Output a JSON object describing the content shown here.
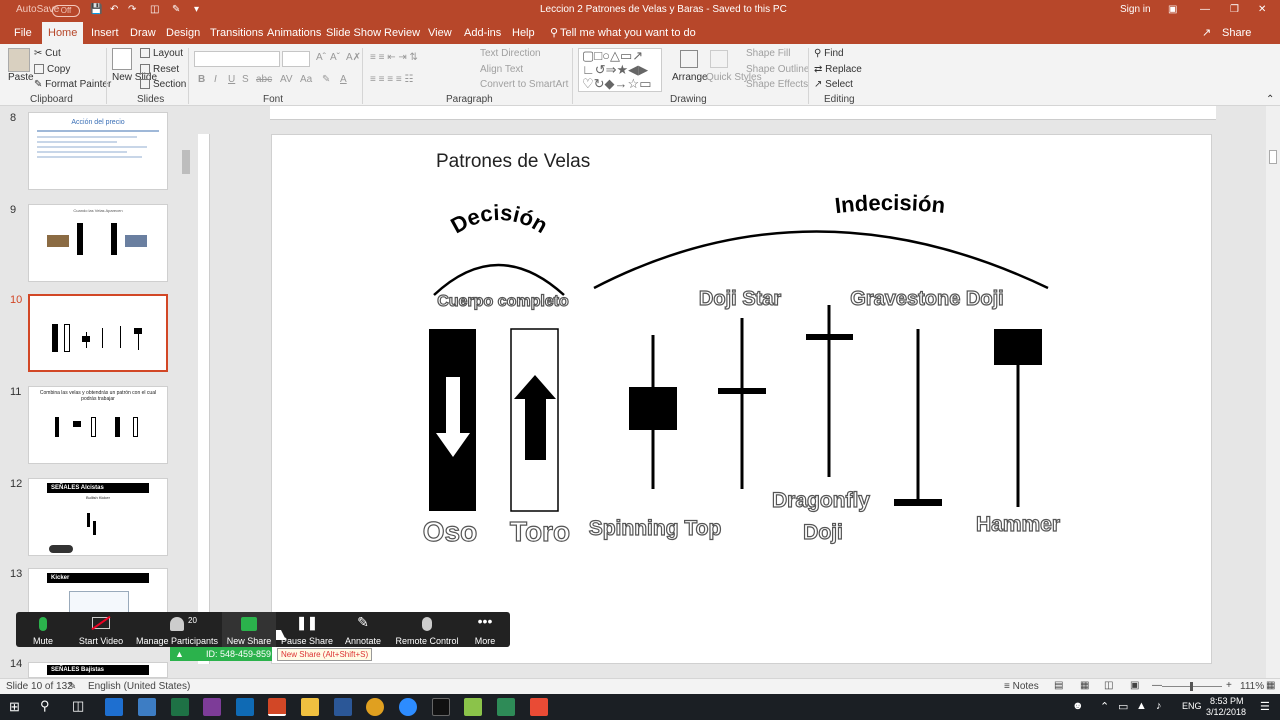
{
  "window": {
    "autosave_label": "AutoSave",
    "autosave_state": "Off",
    "document_title": "Leccion 2 Patrones de Velas y Baras  -  Saved to this PC",
    "sign_in": "Sign in",
    "share": "Share"
  },
  "menu": {
    "tabs": [
      "File",
      "Home",
      "Insert",
      "Draw",
      "Design",
      "Transitions",
      "Animations",
      "Slide Show",
      "Review",
      "View",
      "Add-ins",
      "Help"
    ],
    "tell_me": "Tell me what you want to do"
  },
  "ribbon": {
    "clipboard": {
      "paste": "Paste",
      "cut": "Cut",
      "copy": "Copy",
      "format_painter": "Format Painter",
      "label": "Clipboard"
    },
    "slides": {
      "new_slide": "New Slide",
      "layout": "Layout",
      "reset": "Reset",
      "section": "Section",
      "label": "Slides"
    },
    "font": {
      "label": "Font"
    },
    "paragraph": {
      "text_direction": "Text Direction",
      "align_text": "Align Text",
      "convert_smartart": "Convert to SmartArt",
      "label": "Paragraph"
    },
    "drawing": {
      "arrange": "Arrange",
      "quick_styles": "Quick Styles",
      "shape_fill": "Shape Fill",
      "shape_outline": "Shape Outline",
      "shape_effects": "Shape Effects",
      "label": "Drawing"
    },
    "editing": {
      "find": "Find",
      "replace": "Replace",
      "select": "Select",
      "label": "Editing"
    }
  },
  "thumbnails": [
    {
      "num": "8",
      "title": "Acción del precio"
    },
    {
      "num": "9",
      "title": "Cuando las Velas Aparecen"
    },
    {
      "num": "10",
      "title": ""
    },
    {
      "num": "11",
      "title": "Combina las velas y obtendrás un patrón con el cual podrás trabajar"
    },
    {
      "num": "12",
      "title": "SEÑALES Alcistas",
      "subtitle": "Bullish Kicker"
    },
    {
      "num": "13",
      "title": "Kicker"
    },
    {
      "num": "14",
      "title": "SEÑALES Bajistas"
    }
  ],
  "slide": {
    "title": "Patrones de Velas",
    "arc_decision": "Decisión",
    "arc_indecision": "Indecisión",
    "cuerpo": "Cuerpo completo",
    "doji_star": "Doji Star",
    "gravestone": "Gravestone Doji",
    "oso": "Oso",
    "toro": "Toro",
    "spinning_top": "Spinning Top",
    "dragonfly_1": "Dragonfly",
    "dragonfly_2": "Doji",
    "hammer": "Hammer"
  },
  "zoom_bar": {
    "buttons": [
      "Mute",
      "Start Video",
      "Manage Participants",
      "New Share",
      "Pause Share",
      "Annotate",
      "Remote Control",
      "More"
    ],
    "participants_count": "20",
    "meeting_id": "ID: 548-459-859",
    "tooltip": "New Share (Alt+Shift+S)"
  },
  "status": {
    "slide_counter": "Slide 10 of 132",
    "language": "English (United States)",
    "notes": "Notes",
    "zoom": "111%"
  },
  "taskbar": {
    "lang": "ENG",
    "time": "8:53 PM",
    "date": "3/12/2018"
  }
}
